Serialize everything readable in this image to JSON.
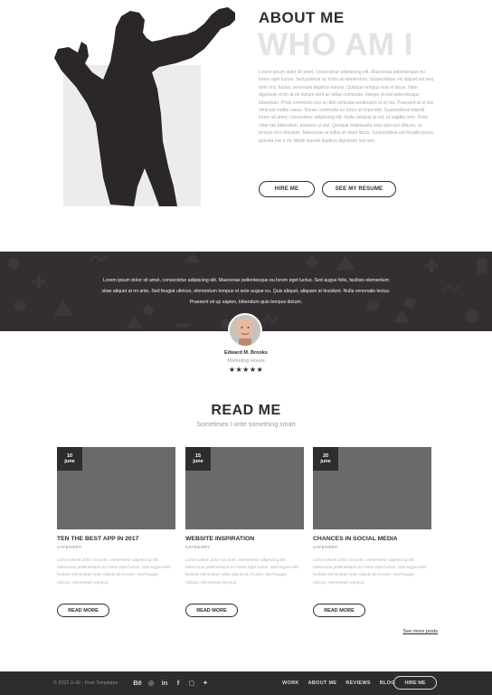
{
  "about": {
    "title": "ABOUT ME",
    "subtitle": "WHO AM I",
    "text": "Lorem ipsum dolor sit amet, consectetur adipisicing elit. Maecenas pellentesque eu lorem eget luctus. Sed pulvinar ac tortor at elementum. Suspendisse vel aliquet est sed, ante orci, luctus, venenatis dapibus mauris. Quisque tempus erat et lacus. Nam dignissim enim at mi dictum sem ac tellus commodo. Integer et nisl pellentesque bibendum. Proin commodo orci ut nibh vehicula vestibulum ut et nisi. Praesent id ut nisi vehicula mattis varius. Donec commodo eu tortor at imperdiet. Suspendisse blandit lorem sit amet, consectetur adipiscing elit. Nulla volutpat at est, ut sagittis sem. Proin vitae nisi bibendum, posuere ut nisi. Quisque malesuada eros quis nisi ultrices, at tempor orci interdum. Maecenas at tellus sit amet lacus. Suspendisse est fringilla purus, gravida nisi a mi. Morbi laoreet dapibus dignissim nisi non.",
    "hire_label": "HIRE ME",
    "resume_label": "SEE MY RESUME"
  },
  "testimonial": {
    "quote": "Lorem ipsum dolor sit amet, consectetur adipiscing elit. Maecenas pellentesque eu lorem eget luctus. Sed augue felis, facilisis elementum vitae aliquet at mi ante. Sed feugiat ultrices, elementum tempus et ante augue eu. Quis aliquet, aliquam at tincidunt. Nulla venenatis lectus. Praesent sit up sapien, bibendum quis tempus dictum.",
    "author": "Edward M. Brooks",
    "role": "Marketing House",
    "stars": "★★★★★"
  },
  "read": {
    "title": "READ ME",
    "subtitle": "Sometimes I write something smart",
    "see_more": "See more posts",
    "cards": [
      {
        "day": "10",
        "month": "june",
        "title": "TEN THE BEST APP IN 2017",
        "category": "CATEGORY",
        "text": "Lorem ipsum dolor sit amet, consectetur adipisicing elit. Maecenas pellentesque eu lorem eget luctus. Sed augue felis, facilisis elementum vitae aliquet at mi ante. Sed feugiat ultrices, elementum tempus.",
        "button": "READ MORE"
      },
      {
        "day": "15",
        "month": "june",
        "title": "WEBSITE INSPIRATION",
        "category": "CATEGORY",
        "text": "Lorem ipsum dolor sit amet, consectetur adipiscing elit. Maecenas pellentesque eu lorem eget luctus. Sed augue felis, facilisis elementum vitae aliquet at mi ante. Sed feugiat ultrices, elementum tempus.",
        "button": "READ MORE"
      },
      {
        "day": "20",
        "month": "june",
        "title": "CHANCES IN SOCIAL MEDIA",
        "category": "CATEGORY",
        "text": "Lorem ipsum dolor sit amet, consectetur adipisicing elit. Maecenas pellentesque eu lorem eget luctus. Sed augue felis, facilisis elementum vitae aliquet at mi ante. Sed feugiat ultrices, elementum tempus.",
        "button": "READ MORE"
      }
    ]
  },
  "footer": {
    "copyright": "© 2022 U-42 · Free Templates",
    "socials": [
      {
        "icon": "behance-icon",
        "glyph": "Bē"
      },
      {
        "icon": "dribbble-icon",
        "glyph": "◎"
      },
      {
        "icon": "linkedin-icon",
        "glyph": "in"
      },
      {
        "icon": "facebook-icon",
        "glyph": "f"
      },
      {
        "icon": "instagram-icon",
        "glyph": "◻"
      },
      {
        "icon": "twitter-icon",
        "glyph": "✦"
      }
    ],
    "nav": [
      "WORK",
      "ABOUT ME",
      "REVIEWS",
      "BLOG"
    ],
    "hire_label": "HIRE ME"
  }
}
